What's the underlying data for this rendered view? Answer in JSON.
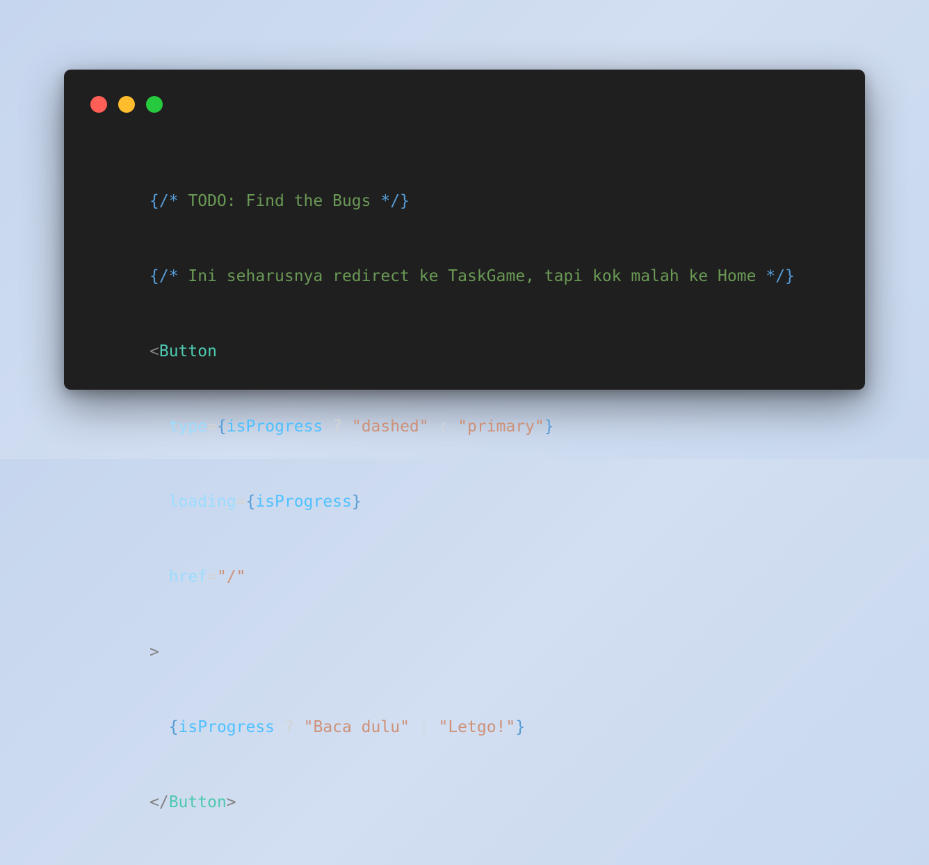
{
  "window": {
    "controls": [
      {
        "name": "close",
        "color": "#ff5f56"
      },
      {
        "name": "minimize",
        "color": "#ffbd2e"
      },
      {
        "name": "maximize",
        "color": "#27c93f"
      }
    ],
    "background_color": "#1f1f1f"
  },
  "code": {
    "line1": {
      "open": "{/*",
      "text": " TODO: Find the Bugs ",
      "close": "*/}"
    },
    "line2": {
      "open": "{/*",
      "text": " Ini seharusnya redirect ke TaskGame, tapi kok malah ke Home ",
      "close": "*/}"
    },
    "line3": {
      "lt": "<",
      "tag": "Button"
    },
    "line4": {
      "indent": "  ",
      "attr": "type",
      "eq": "=",
      "lbrace": "{",
      "var": "isProgress",
      "q": " ? ",
      "str1": "\"dashed\"",
      "colon": " : ",
      "str2": "\"primary\"",
      "rbrace": "}"
    },
    "line5": {
      "indent": "  ",
      "attr": "loading",
      "eq": "=",
      "lbrace": "{",
      "var": "isProgress",
      "rbrace": "}"
    },
    "line6": {
      "indent": "  ",
      "attr": "href",
      "eq": "=",
      "str": "\"/\""
    },
    "line7": {
      "gt": ">"
    },
    "line8": {
      "indent": "  ",
      "lbrace": "{",
      "var": "isProgress",
      "q": " ? ",
      "str1": "\"Baca dulu\"",
      "colon": " : ",
      "str2": "\"Letgo!\"",
      "rbrace": "}"
    },
    "line9": {
      "lt": "</",
      "tag": "Button",
      "gt": ">"
    }
  }
}
